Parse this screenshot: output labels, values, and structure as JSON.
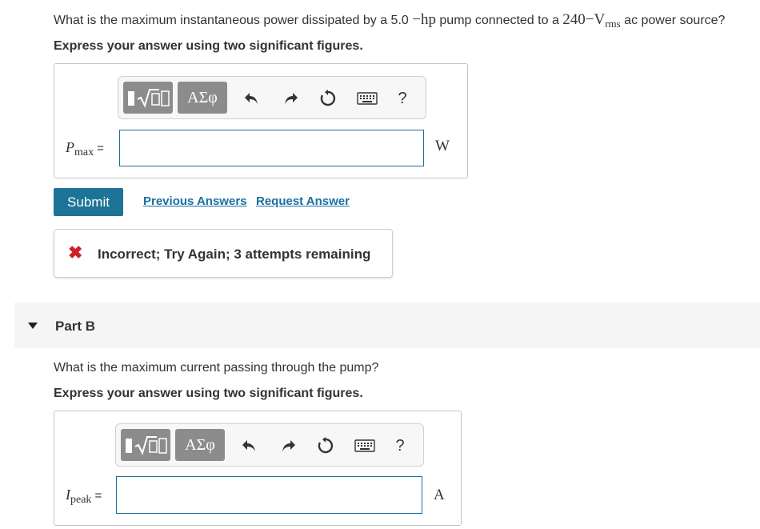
{
  "partA": {
    "question": {
      "pre": "What is the maximum instantaneous power dissipated by a 5.0 ",
      "m1": "−hp",
      "mid": " pump connected to a ",
      "m2": "240−V",
      "m2sub": "rms",
      "post": " ac power source?"
    },
    "instruction": "Express your answer using two significant figures.",
    "toolbar": {
      "greek_label": "ΑΣφ",
      "help_label": "?"
    },
    "variable": {
      "symbol": "P",
      "subscript": "max",
      "equals": "="
    },
    "input_value": "",
    "unit": "W",
    "submit_label": "Submit",
    "links": {
      "previous": "Previous Answers",
      "request": "Request Answer"
    },
    "feedback": {
      "icon": "✖",
      "text": "Incorrect; Try Again; 3 attempts remaining",
      "icon_color": "#cc2229"
    }
  },
  "partB": {
    "title": "Part B",
    "question": "What is the maximum current passing through the pump?",
    "instruction": "Express your answer using two significant figures.",
    "toolbar": {
      "greek_label": "ΑΣφ",
      "help_label": "?"
    },
    "variable": {
      "symbol": "I",
      "subscript": "peak",
      "equals": "="
    },
    "input_value": "",
    "unit": "A"
  },
  "colors": {
    "accent": "#1d7496",
    "link": "#1a6fa3",
    "error": "#cc2229",
    "input_border": "#1e6e9a"
  }
}
